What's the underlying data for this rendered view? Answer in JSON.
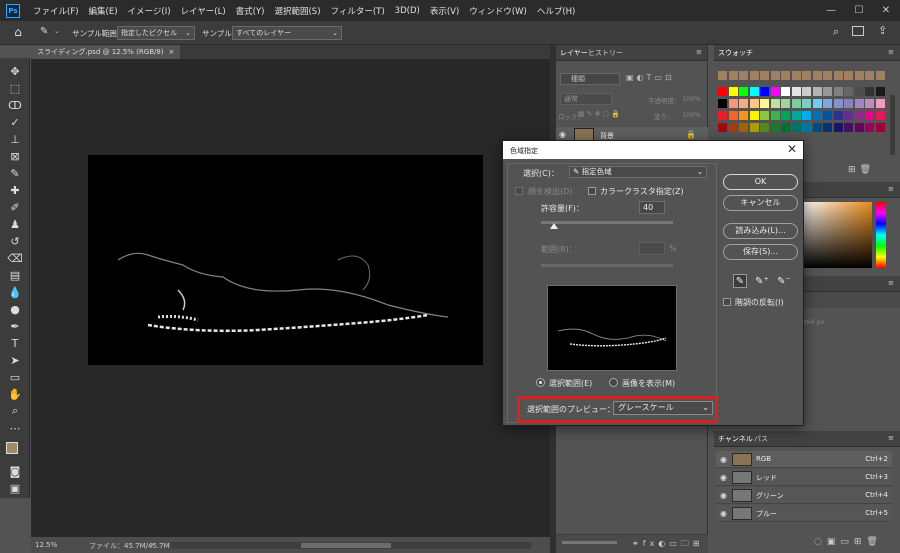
{
  "menubar": {
    "logo": "Ps",
    "items": [
      "ファイル(F)",
      "編集(E)",
      "イメージ(I)",
      "レイヤー(L)",
      "書式(Y)",
      "選択範囲(S)",
      "フィルター(T)",
      "3D(D)",
      "表示(V)",
      "ウィンドウ(W)",
      "ヘルプ(H)"
    ],
    "window_controls": [
      "—",
      "☐",
      "✕"
    ]
  },
  "options_bar": {
    "sample_size_label": "サンプル範囲：",
    "sample_size_value": "指定したピクセル",
    "sample_label": "サンプル：",
    "sample_value": "すべてのレイヤー"
  },
  "document": {
    "tab_title": "スライディング.psd @ 12.5% (RGB/8)",
    "tab_close": "×",
    "zoom": "12.5%",
    "file_info": "ファイル：45.7M/45.7M"
  },
  "layers_panel": {
    "tabs": [
      "レイヤー",
      "ヒストリー"
    ],
    "filter": "種類",
    "blend_mode": "通常",
    "opacity_label": "不透明度：",
    "opacity": "100%",
    "lock_label": "ロック：",
    "fill_label": "塗り：",
    "fill": "100%",
    "layer_name": "背景"
  },
  "swatches_panel": {
    "tab": "スウォッチ",
    "colors": [
      "#a08060",
      "#a08060",
      "#a08060",
      "#a08060",
      "#a08060",
      "#a08060",
      "#a08060",
      "#a08060",
      "#a08060",
      "#a08060",
      "#a08060",
      "#a08060",
      "#a08060",
      "#a08060",
      "#a08060",
      "#a08060",
      "#ff0000",
      "#ffff00",
      "#00ff00",
      "#00ffff",
      "#0000ff",
      "#ff00ff",
      "#ffffff",
      "#e6e6e6",
      "#cccccc",
      "#b3b3b3",
      "#999999",
      "#808080",
      "#666666",
      "#4d4d4d",
      "#333333",
      "#1a1a1a",
      "#000000",
      "#f7977a",
      "#f9ad81",
      "#fdc68a",
      "#fff79a",
      "#c4df9b",
      "#a3d39c",
      "#82ca9d",
      "#7bcdc8",
      "#6ecff6",
      "#7ea7d8",
      "#8493ca",
      "#8882be",
      "#a187be",
      "#bc8dbf",
      "#f49ac2",
      "#ed1c24",
      "#f26522",
      "#f7941d",
      "#fff200",
      "#8dc63f",
      "#39b54a",
      "#00a651",
      "#00a99d",
      "#00aeef",
      "#0072bc",
      "#0054a6",
      "#2e3192",
      "#662d91",
      "#92278f",
      "#ec008c",
      "#ed145b",
      "#9e0b0f",
      "#a0410d",
      "#a36209",
      "#aba000",
      "#598527",
      "#1a7b30",
      "#007236",
      "#00746b",
      "#0076a3",
      "#004a80",
      "#003471",
      "#1b1464",
      "#440e62",
      "#630460",
      "#9e005d",
      "#9e0039"
    ]
  },
  "channels_panel": {
    "tabs": [
      "チャンネル",
      "パス"
    ],
    "channels": [
      {
        "name": "RGB",
        "shortcut": "Ctrl+2"
      },
      {
        "name": "レッド",
        "shortcut": "Ctrl+3"
      },
      {
        "name": "グリーン",
        "shortcut": "Ctrl+4"
      },
      {
        "name": "ブルー",
        "shortcut": "Ctrl+5"
      }
    ]
  },
  "mid_panel": {
    "info_text": "264 px"
  },
  "color_range_dialog": {
    "title": "色域指定",
    "close": "✕",
    "select_label": "選択(C)：",
    "select_value": "指定色域",
    "localized_clusters": "顔を検出(D)",
    "localized_color_clusters": "カラークラスタ指定(Z)",
    "fuzziness_label": "許容量(F)：",
    "fuzziness_value": "40",
    "range_label": "範囲(R)：",
    "range_unit": "%",
    "fuzziness_level": 0.1,
    "selection_radio": "選択範囲(E)",
    "image_radio": "画像を表示(M)",
    "preview_label": "選択範囲のプレビュー：",
    "preview_value": "グレースケール",
    "ok": "OK",
    "cancel": "キャンセル",
    "load": "読み込み(L)...",
    "save": "保存(S)...",
    "invert": "階調の反転(I)"
  }
}
